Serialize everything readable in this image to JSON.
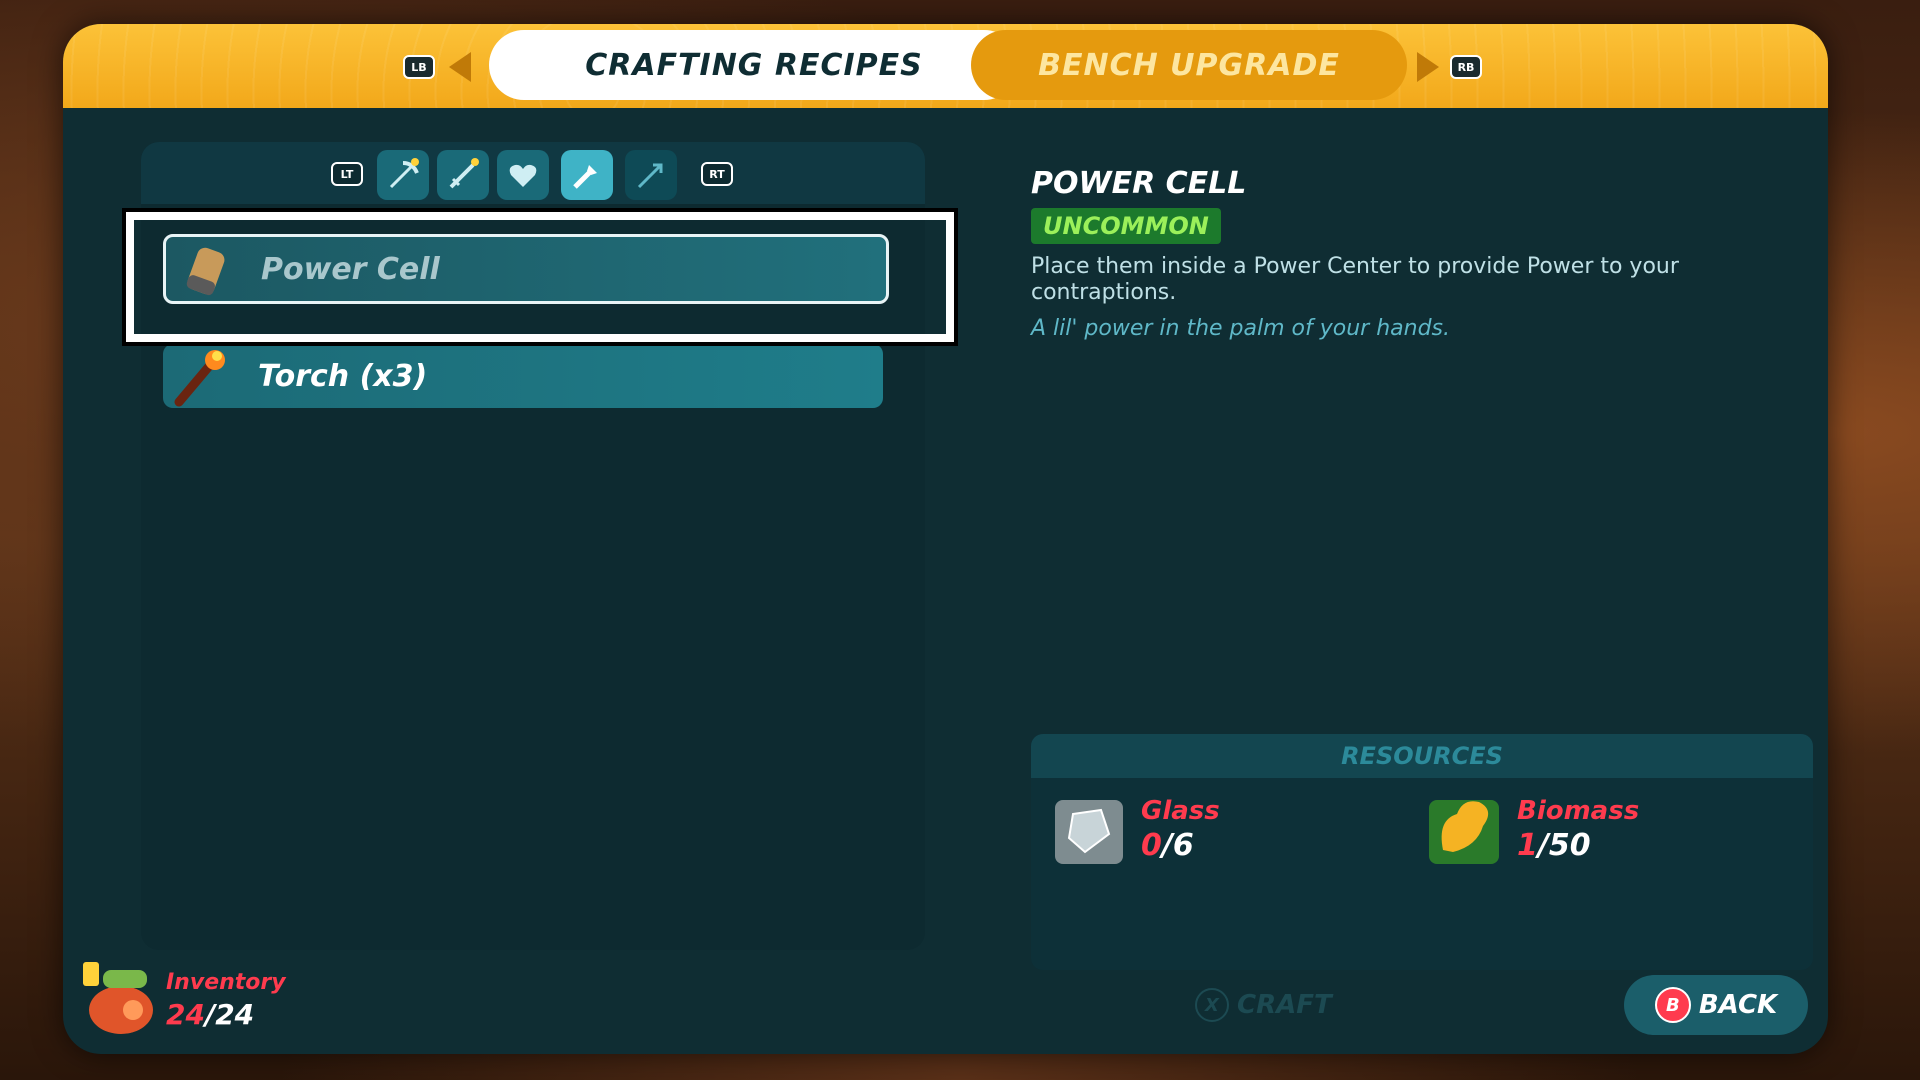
{
  "header": {
    "left_bumper": "LB",
    "right_bumper": "RB",
    "tabs": [
      {
        "label": "CRAFTING RECIPES",
        "active": true
      },
      {
        "label": "BENCH UPGRADE",
        "active": false
      }
    ]
  },
  "categories": {
    "left_trigger": "LT",
    "right_trigger": "RT",
    "items": [
      {
        "icon": "pickaxe-icon"
      },
      {
        "icon": "sword-icon"
      },
      {
        "icon": "heart-icon"
      },
      {
        "icon": "torch-icon",
        "selected": true
      },
      {
        "icon": "arrow-icon"
      }
    ]
  },
  "recipes": [
    {
      "name": "Power Cell",
      "icon": "power-cell-icon",
      "selected": true
    },
    {
      "name": "Torch (x3)",
      "icon": "torch-icon"
    }
  ],
  "detail": {
    "title": "POWER CELL",
    "rarity": "UNCOMMON",
    "description": "Place them inside a Power Center to provide Power to your contraptions.",
    "flavor": "A lil' power in the palm of your hands."
  },
  "resources": {
    "header": "RESOURCES",
    "items": [
      {
        "name": "Glass",
        "have": "0",
        "need": "/6",
        "icon": "glass-icon"
      },
      {
        "name": "Biomass",
        "have": "1",
        "need": "/50",
        "icon": "biomass-icon"
      }
    ]
  },
  "inventory": {
    "label": "Inventory",
    "have": "24",
    "max": "/24"
  },
  "actions": {
    "craft_key": "X",
    "craft_label": "CRAFT",
    "back_key": "B",
    "back_label": "BACK"
  },
  "colors": {
    "accent": "#fcc238",
    "panel": "#0f2d33",
    "alert": "#ff3b4e",
    "rarity": "#9bf05a"
  }
}
